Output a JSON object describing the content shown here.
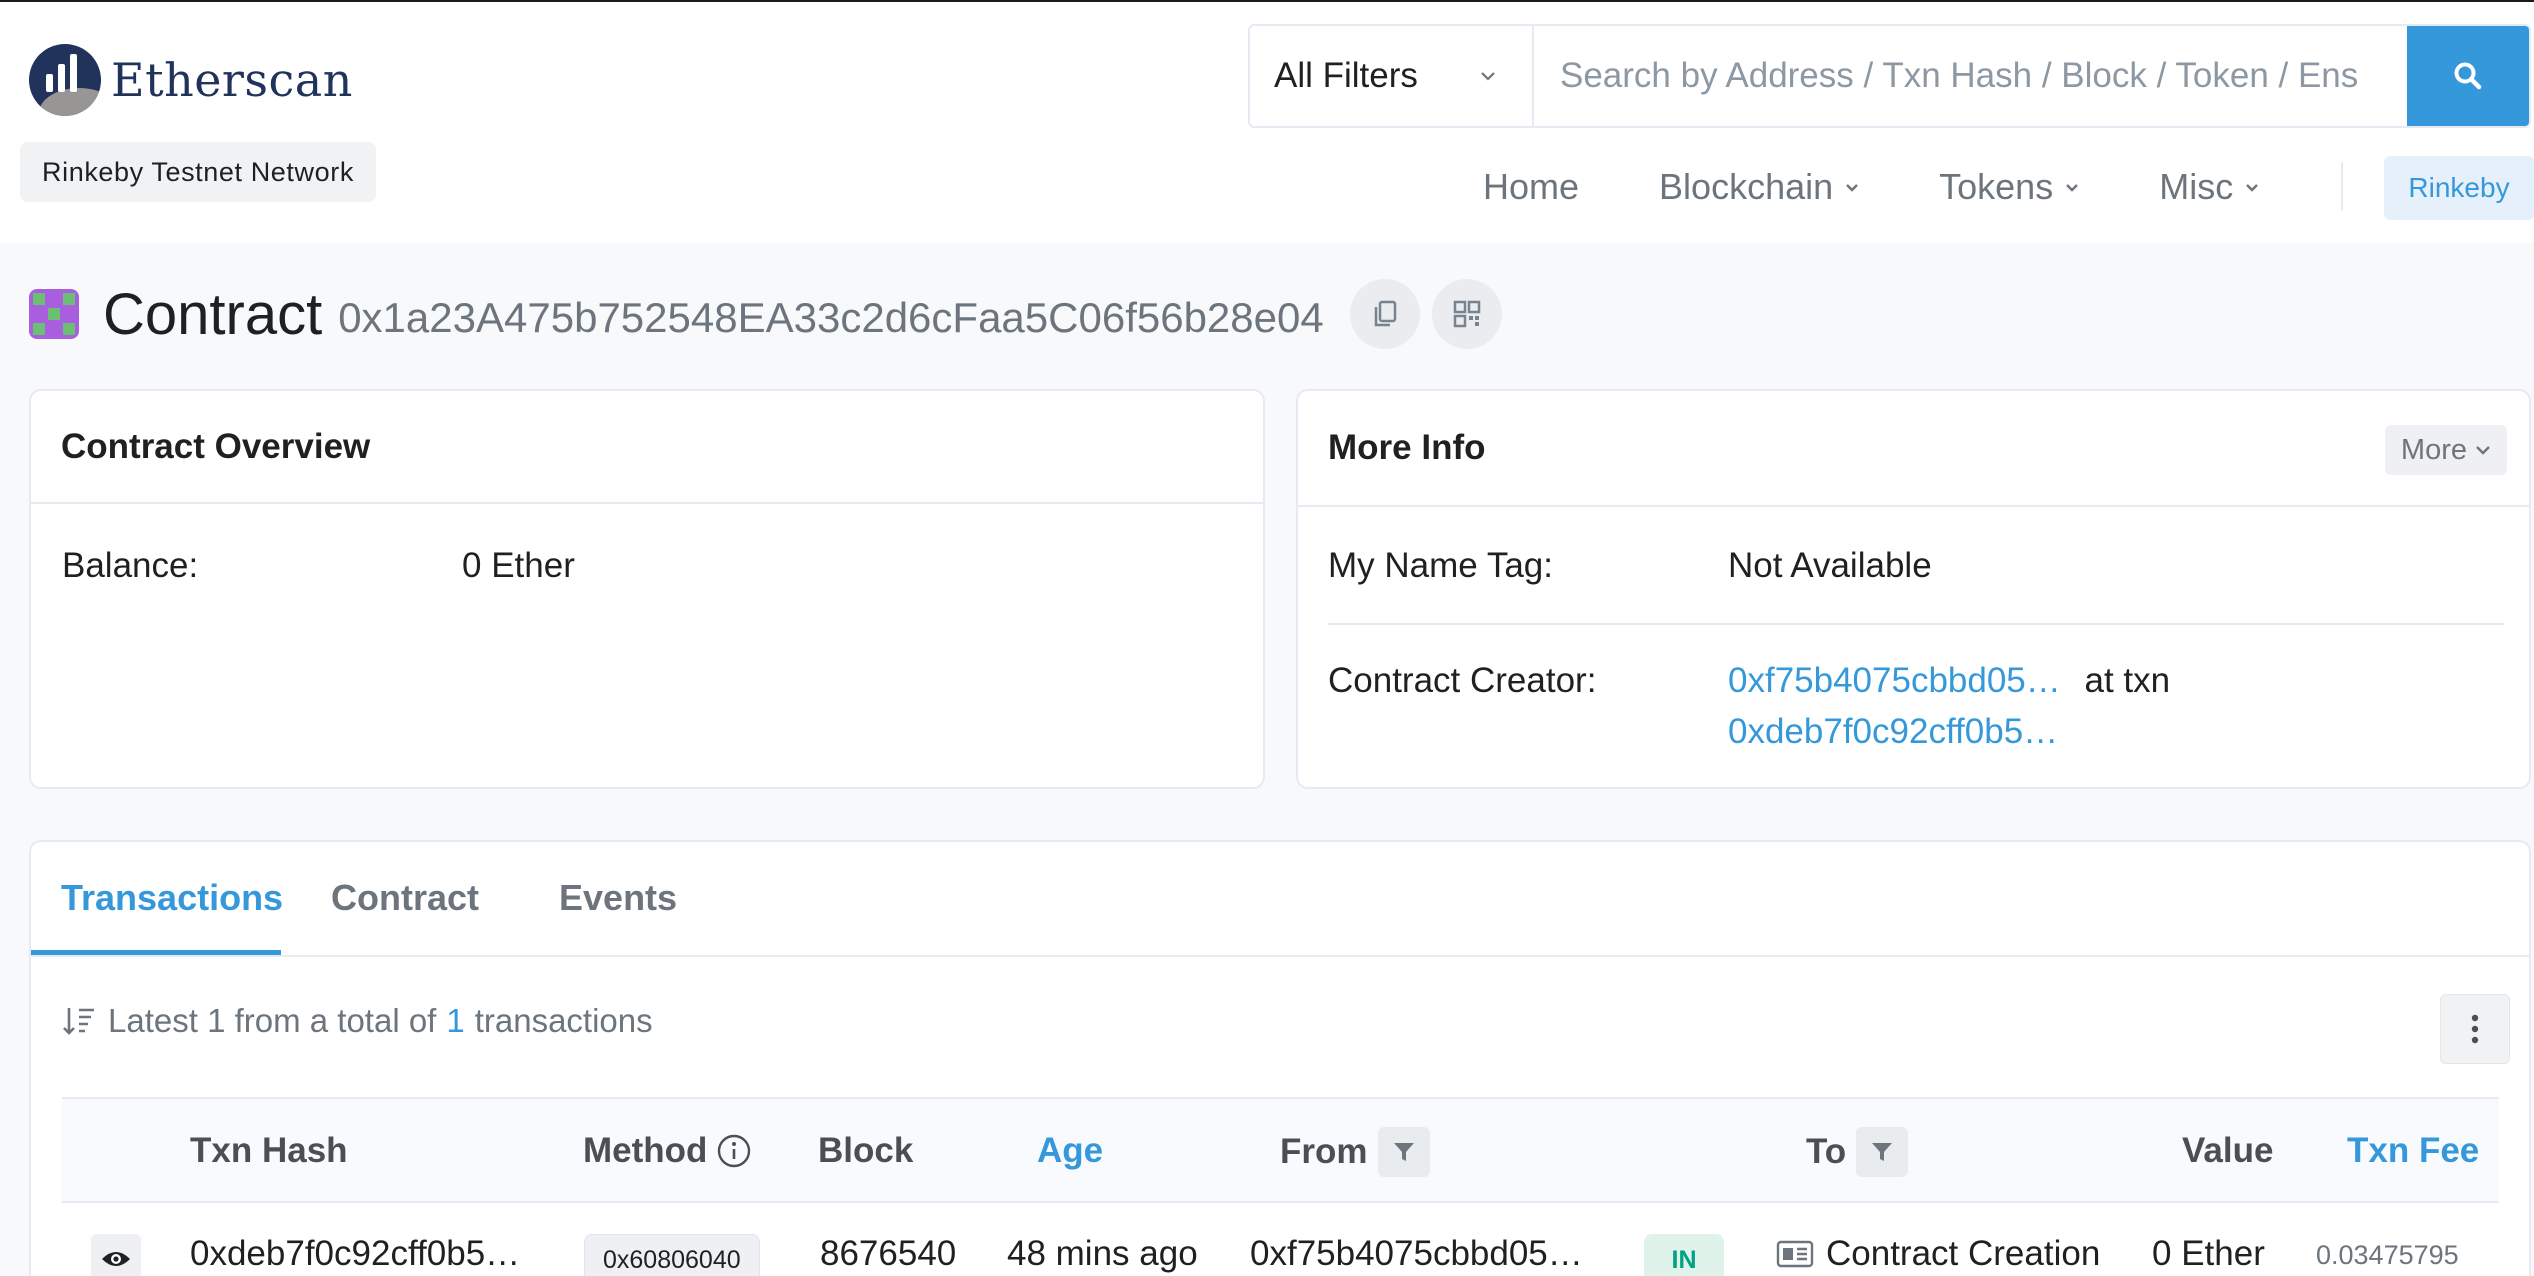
{
  "brand": {
    "name": "Etherscan",
    "network_label": "Rinkeby Testnet Network"
  },
  "search": {
    "filter_selected": "All Filters",
    "placeholder": "Search by Address / Txn Hash / Block / Token / Ens"
  },
  "nav": {
    "items": [
      {
        "label": "Home",
        "dropdown": false
      },
      {
        "label": "Blockchain",
        "dropdown": true
      },
      {
        "label": "Tokens",
        "dropdown": true
      },
      {
        "label": "Misc",
        "dropdown": true
      }
    ],
    "network": "Rinkeby"
  },
  "page": {
    "type_label": "Contract",
    "address": "0x1a23A475b752548EA33c2d6cFaa5C06f56b28e04"
  },
  "overview": {
    "title": "Contract Overview",
    "balance_label": "Balance:",
    "balance_value": "0 Ether"
  },
  "more_info": {
    "title": "More Info",
    "more_button": "More",
    "name_tag_label": "My Name Tag:",
    "name_tag_value": "Not Available",
    "creator_label": "Contract Creator:",
    "creator_address": "0xf75b4075cbbd05…",
    "at_txn": "at txn",
    "creator_txn": "0xdeb7f0c92cff0b5…"
  },
  "tabs": [
    "Transactions",
    "Contract",
    "Events"
  ],
  "transactions": {
    "summary_prefix": "Latest 1 from a total of",
    "summary_count": "1",
    "summary_suffix": "transactions",
    "columns": {
      "hash": "Txn Hash",
      "method": "Method",
      "block": "Block",
      "age": "Age",
      "from": "From",
      "to": "To",
      "value": "Value",
      "fee": "Txn Fee"
    },
    "rows": [
      {
        "hash": "0xdeb7f0c92cff0b5…",
        "method": "0x60806040",
        "block": "8676540",
        "age": "48 mins ago",
        "from": "0xf75b4075cbbd05…",
        "direction": "IN",
        "to": "Contract Creation",
        "value": "0 Ether",
        "fee": "0.03475795"
      }
    ]
  },
  "colors": {
    "accent": "#3498db",
    "brand_navy": "#21325b",
    "in_badge": "#00a186"
  }
}
